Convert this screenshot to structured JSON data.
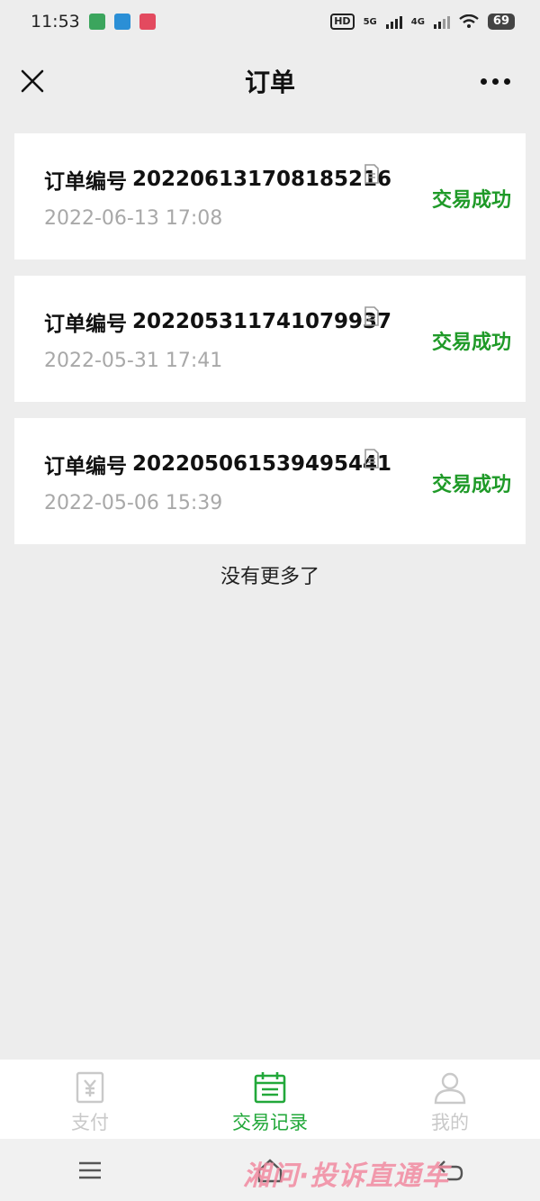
{
  "status_bar": {
    "time": "11:53",
    "network": "5G",
    "network2": "4G",
    "battery": "69"
  },
  "nav": {
    "title": "订单",
    "close_icon": "close-icon",
    "more_icon": "more-icon"
  },
  "orders": [
    {
      "label": "订单编号",
      "number": "202206131708185216",
      "time": "2022-06-13 17:08",
      "status": "交易成功"
    },
    {
      "label": "订单编号",
      "number": "202205311741079937",
      "time": "2022-05-31 17:41",
      "status": "交易成功"
    },
    {
      "label": "订单编号",
      "number": "202205061539495441",
      "time": "2022-05-06 15:39",
      "status": "交易成功"
    }
  ],
  "footer_text": "没有更多了",
  "tabs": [
    {
      "label": "支付",
      "icon": "receipt-icon",
      "active": false
    },
    {
      "label": "交易记录",
      "icon": "calendar-icon",
      "active": true
    },
    {
      "label": "我的",
      "icon": "user-icon",
      "active": false
    }
  ],
  "watermark": "湘问·投诉直通车",
  "colors": {
    "accent": "#22a83a",
    "status_success": "#1f9a28",
    "background": "#ededed"
  }
}
